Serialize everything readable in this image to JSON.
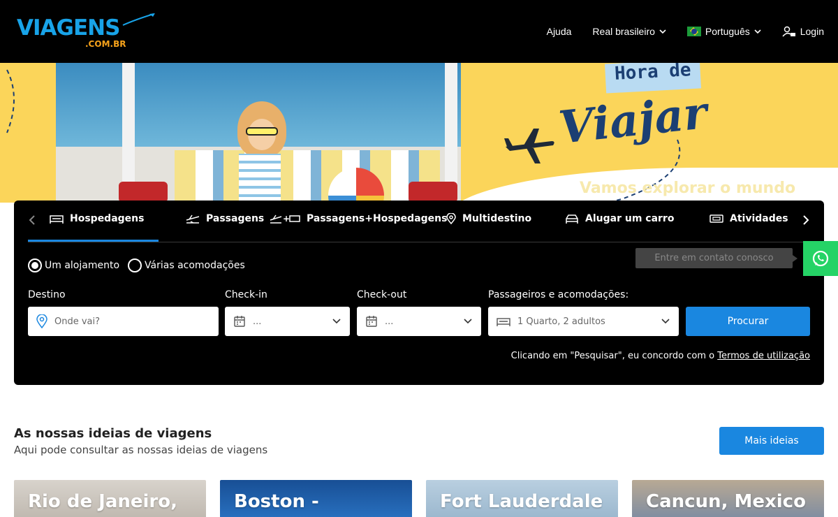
{
  "brand": {
    "logo_main_a": "VIAGENS",
    "logo_sub": ".COM.BR"
  },
  "nav": {
    "help": "Ajuda",
    "currency": "Real brasileiro",
    "language": "Português",
    "login": "Login"
  },
  "hero": {
    "title_top": "Hora de",
    "title_main": "Viajar",
    "subtitle": "Vamos explorar o mundo"
  },
  "tabs": [
    {
      "label": "Hospedagens",
      "icon": "bed-icon"
    },
    {
      "label": "Passagens",
      "icon": "plane-icon"
    },
    {
      "label": "Passagens+Hospedagens",
      "icon": "plane-bed-icon"
    },
    {
      "label": "Multidestino",
      "icon": "map-pin-icon"
    },
    {
      "label": "Alugar um carro",
      "icon": "car-icon"
    },
    {
      "label": "Atividades",
      "icon": "ticket-icon"
    }
  ],
  "search": {
    "radio_single": "Um alojamento",
    "radio_multi": "Várias acomodações",
    "destination_label": "Destino",
    "destination_placeholder": "Onde vai?",
    "checkin_label": "Check-in",
    "checkin_value": "...",
    "checkout_label": "Check-out",
    "checkout_value": "...",
    "guests_label": "Passageiros e acomodações:",
    "guests_value": "1 Quarto, 2 adultos",
    "search_button": "Procurar",
    "terms_prefix": "Clicando em \"Pesquisar\", eu concordo com o ",
    "terms_link": "Termos de utilização"
  },
  "contact": {
    "tooltip": "Entre em contato conosco"
  },
  "ideas": {
    "title": "As nossas ideias de viagens",
    "subtitle": "Aqui pode consultar as nossas ideias de viagens",
    "more_button": "Mais ideias",
    "cards": [
      {
        "title": "Rio de Janeiro,",
        "color": "#c9c4bd"
      },
      {
        "title": "Boston -",
        "color": "#1d5ea8"
      },
      {
        "title": "Fort Lauderdale",
        "color": "#a8c3d6"
      },
      {
        "title": "Cancun, Mexico",
        "color": "#8a98ab"
      }
    ]
  },
  "colors": {
    "accent": "#1a87e0",
    "header_bg": "#000000",
    "hero_bg": "#fbd55a",
    "whatsapp": "#25d366"
  }
}
